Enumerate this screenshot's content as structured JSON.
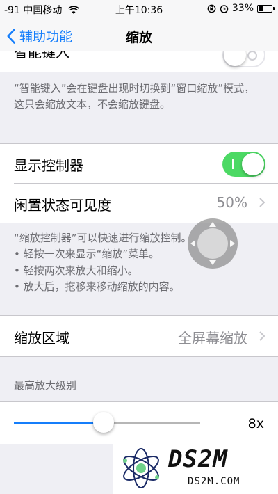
{
  "status_bar": {
    "signal": "-91",
    "carrier": "中国移动",
    "time": "上午10:36",
    "battery": "33%",
    "battery_level": 0.33
  },
  "nav": {
    "back_label": "辅助功能",
    "title": "缩放"
  },
  "smart_typing": {
    "label": "智能键入",
    "enabled": false,
    "description": "“智能键入”会在键盘出现时切换到“窗口缩放”模式，这只会缩放文本，不会缩放键盘。"
  },
  "show_controller": {
    "label": "显示控制器",
    "enabled": true
  },
  "idle_visibility": {
    "label": "闲置状态可见度",
    "value": "50%"
  },
  "controller_notes": {
    "intro": "“缩放控制器”可以快速进行缩放控制。",
    "bullet1": "• 轻按一次来显示“缩放”菜单。",
    "bullet2": "• 轻按两次来放大和缩小。",
    "bullet3": "• 放大后，拖移来移动缩放的内容。"
  },
  "zoom_region": {
    "label": "缩放区域",
    "value": "全屏幕缩放"
  },
  "max_zoom": {
    "header": "最高放大级别",
    "value_label": "8x",
    "fraction": 0.48
  },
  "watermark": {
    "big": "DS2M",
    "small": "DS2M.COM"
  },
  "colors": {
    "accent": "#157efb",
    "toggle_on": "#4cd964",
    "background": "#efeff4"
  }
}
